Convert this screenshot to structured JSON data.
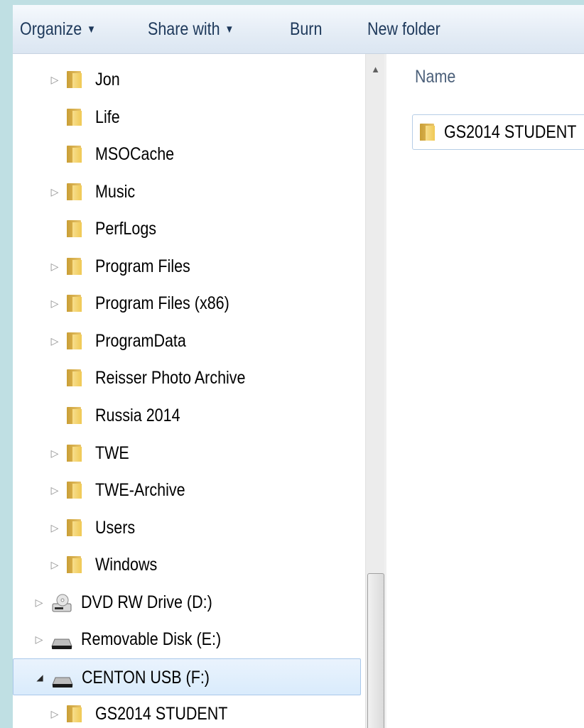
{
  "toolbar": {
    "organize": "Organize",
    "share_with": "Share with",
    "burn": "Burn",
    "new_folder": "New folder",
    "dropdown_arrow": "▼"
  },
  "nav": {
    "items": [
      {
        "label": "Jon",
        "expandable": true
      },
      {
        "label": "Life",
        "expandable": false
      },
      {
        "label": "MSOCache",
        "expandable": false
      },
      {
        "label": "Music",
        "expandable": true
      },
      {
        "label": "PerfLogs",
        "expandable": false
      },
      {
        "label": "Program Files",
        "expandable": true
      },
      {
        "label": "Program Files (x86)",
        "expandable": true
      },
      {
        "label": "ProgramData",
        "expandable": true
      },
      {
        "label": "Reisser Photo Archive",
        "expandable": false
      },
      {
        "label": "Russia 2014",
        "expandable": false
      },
      {
        "label": "TWE",
        "expandable": true
      },
      {
        "label": "TWE-Archive",
        "expandable": true
      },
      {
        "label": "Users",
        "expandable": true
      },
      {
        "label": "Windows",
        "expandable": true
      }
    ],
    "drives": [
      {
        "label": "DVD RW Drive (D:)",
        "icon": "dvd-drive-icon"
      },
      {
        "label": "Removable Disk (E:)",
        "icon": "removable-disk-icon"
      },
      {
        "label": "CENTON USB (F:)",
        "icon": "usb-drive-icon",
        "selected": true,
        "expanded": true
      }
    ],
    "child": {
      "label": "GS2014 STUDENT",
      "expandable": true
    }
  },
  "content": {
    "column_header": "Name",
    "files": [
      {
        "name": "GS2014 STUDENT",
        "icon": "folder-icon"
      }
    ]
  },
  "colors": {
    "selection_border": "#a9c8ea",
    "toolbar_text": "#1e395b",
    "folder_yellow": "#f0c954"
  }
}
